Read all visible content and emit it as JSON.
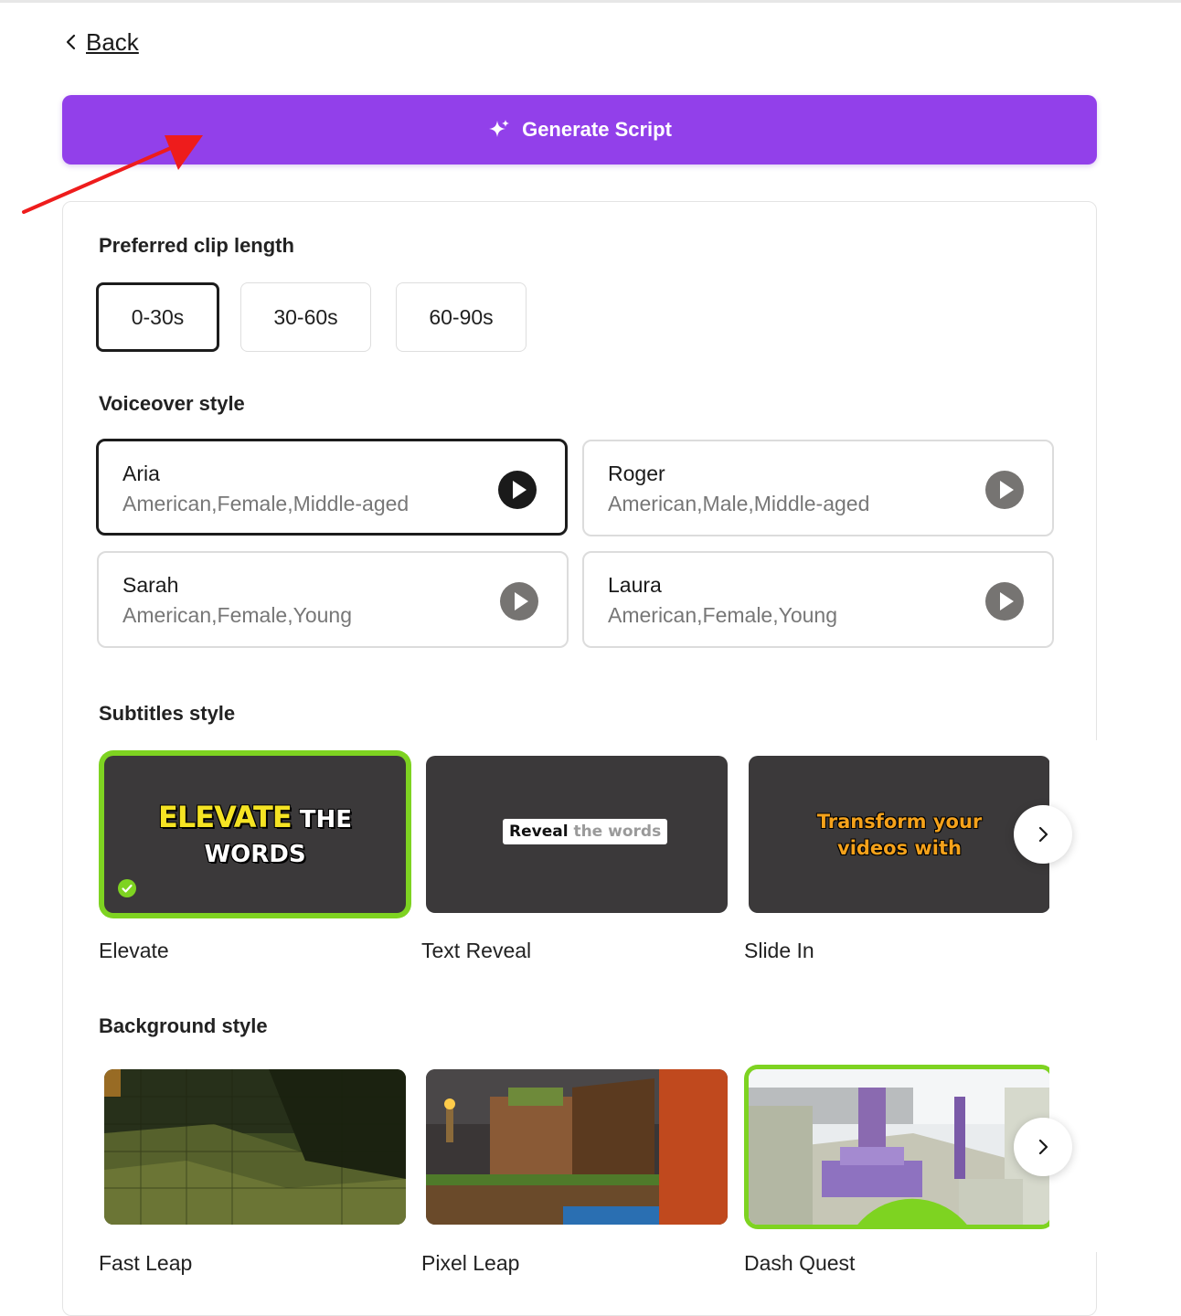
{
  "nav": {
    "back_label": "Back"
  },
  "generate_button": {
    "label": "Generate Script"
  },
  "clip_length": {
    "title": "Preferred clip length",
    "options": [
      "0-30s",
      "30-60s",
      "60-90s"
    ],
    "selected": "0-30s"
  },
  "voiceover": {
    "title": "Voiceover style",
    "voices": [
      {
        "name": "Aria",
        "desc": "American,Female,Middle-aged"
      },
      {
        "name": "Roger",
        "desc": "American,Male,Middle-aged"
      },
      {
        "name": "Sarah",
        "desc": "American,Female,Young"
      },
      {
        "name": "Laura",
        "desc": "American,Female,Young"
      }
    ],
    "selected": "Aria"
  },
  "subtitles": {
    "title": "Subtitles style",
    "items": [
      {
        "name": "Elevate",
        "preview_line1_highlight": "ELEVATE",
        "preview_line1_rest": "THE",
        "preview_line2": "WORDS"
      },
      {
        "name": "Text Reveal",
        "preview_dark": "Reveal",
        "preview_grey": "the words"
      },
      {
        "name": "Slide In",
        "preview_line1": "Transform your",
        "preview_line2": "videos with"
      }
    ],
    "selected": "Elevate"
  },
  "background": {
    "title": "Background style",
    "items": [
      {
        "name": "Fast Leap"
      },
      {
        "name": "Pixel Leap"
      },
      {
        "name": "Dash Quest"
      }
    ],
    "selected": "Dash Quest"
  },
  "colors": {
    "accent_purple": "#9240ea",
    "selected_green": "#7ed321",
    "annotation_red": "#ee1c1c"
  }
}
